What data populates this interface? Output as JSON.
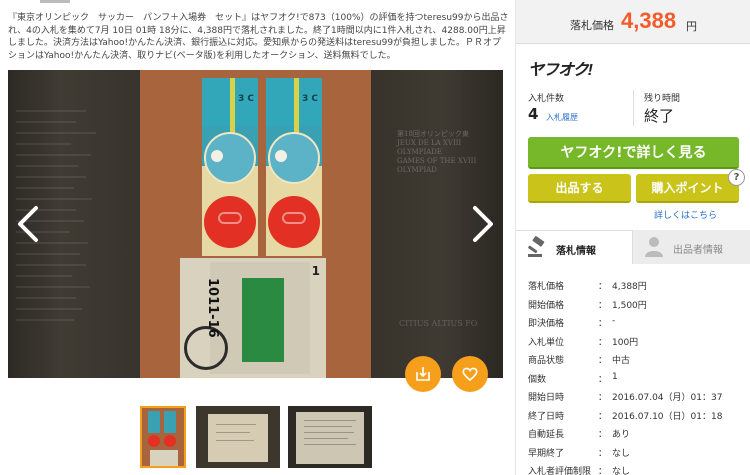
{
  "description": "『東京オリンピック　サッカー　パンフ＋入場券　セット』はヤフオク!で873（100%）の評価を持つteresu99から出品され、4の入札を集めて7月 10日 01時 18分に、4,388円で落札されました。終了1時間以内に1件入札され、4288.00円上昇しました。決済方法はYahoo!かんたん決済、銀行振込に対応。愛知県からの発送料はteresu99が負担しました。ＰＲオプションはYahoo!かんたん決済、取りナビ(ベータ版)を利用したオークション、送料無料でした。",
  "gallery": {
    "nav_prev": "prev-arrow",
    "nav_next": "next-arrow",
    "program_title": "1011-16",
    "program_number": "1",
    "ticket_seat": "3 C",
    "right_doc_lines": [
      "第18回オリンピック東",
      "JEUX DE LA XVIII OLYMPIADE",
      "GAMES OF THE XVIII OLYMPIAD"
    ],
    "right_doc_bottom": "CITIUS ALTIUS FO"
  },
  "panel": {
    "price_label": "落札価格",
    "price_value": "4,388",
    "price_unit": "円",
    "logo": "ヤフオク!",
    "bids_label": "入札件数",
    "bids_value": "4",
    "bids_history_link": "入札履歴",
    "remaining_label": "残り時間",
    "remaining_value": "終了",
    "main_button": "ヤフオク!で詳しく見る",
    "sell_button": "出品する",
    "points_button": "購入ポイント",
    "help_icon": "?",
    "more_link": "詳しくはこちら",
    "tab_bid_info": "落札情報",
    "tab_seller_info": "出品者情報",
    "colors": {
      "price": "#f25c2a",
      "green": "#76b82a",
      "olive": "#c9c31a",
      "orange": "#f59f1b",
      "link": "#2a6fc9"
    }
  },
  "info_rows": [
    {
      "k": "落札価格",
      "v": "4,388円"
    },
    {
      "k": "開始価格",
      "v": "1,500円"
    },
    {
      "k": "即決価格",
      "v": "-"
    },
    {
      "k": "入札単位",
      "v": "100円"
    },
    {
      "k": "商品状態",
      "v": "中古"
    },
    {
      "k": "個数",
      "v": "1"
    },
    {
      "k": "開始日時",
      "v": "2016.07.04（月）01：37"
    },
    {
      "k": "終了日時",
      "v": "2016.07.10（日）01：18"
    },
    {
      "k": "自動延長",
      "v": "あり"
    },
    {
      "k": "早期終了",
      "v": "なし"
    },
    {
      "k": "入札者評価制限",
      "v": "なし"
    }
  ],
  "info_separator": "："
}
